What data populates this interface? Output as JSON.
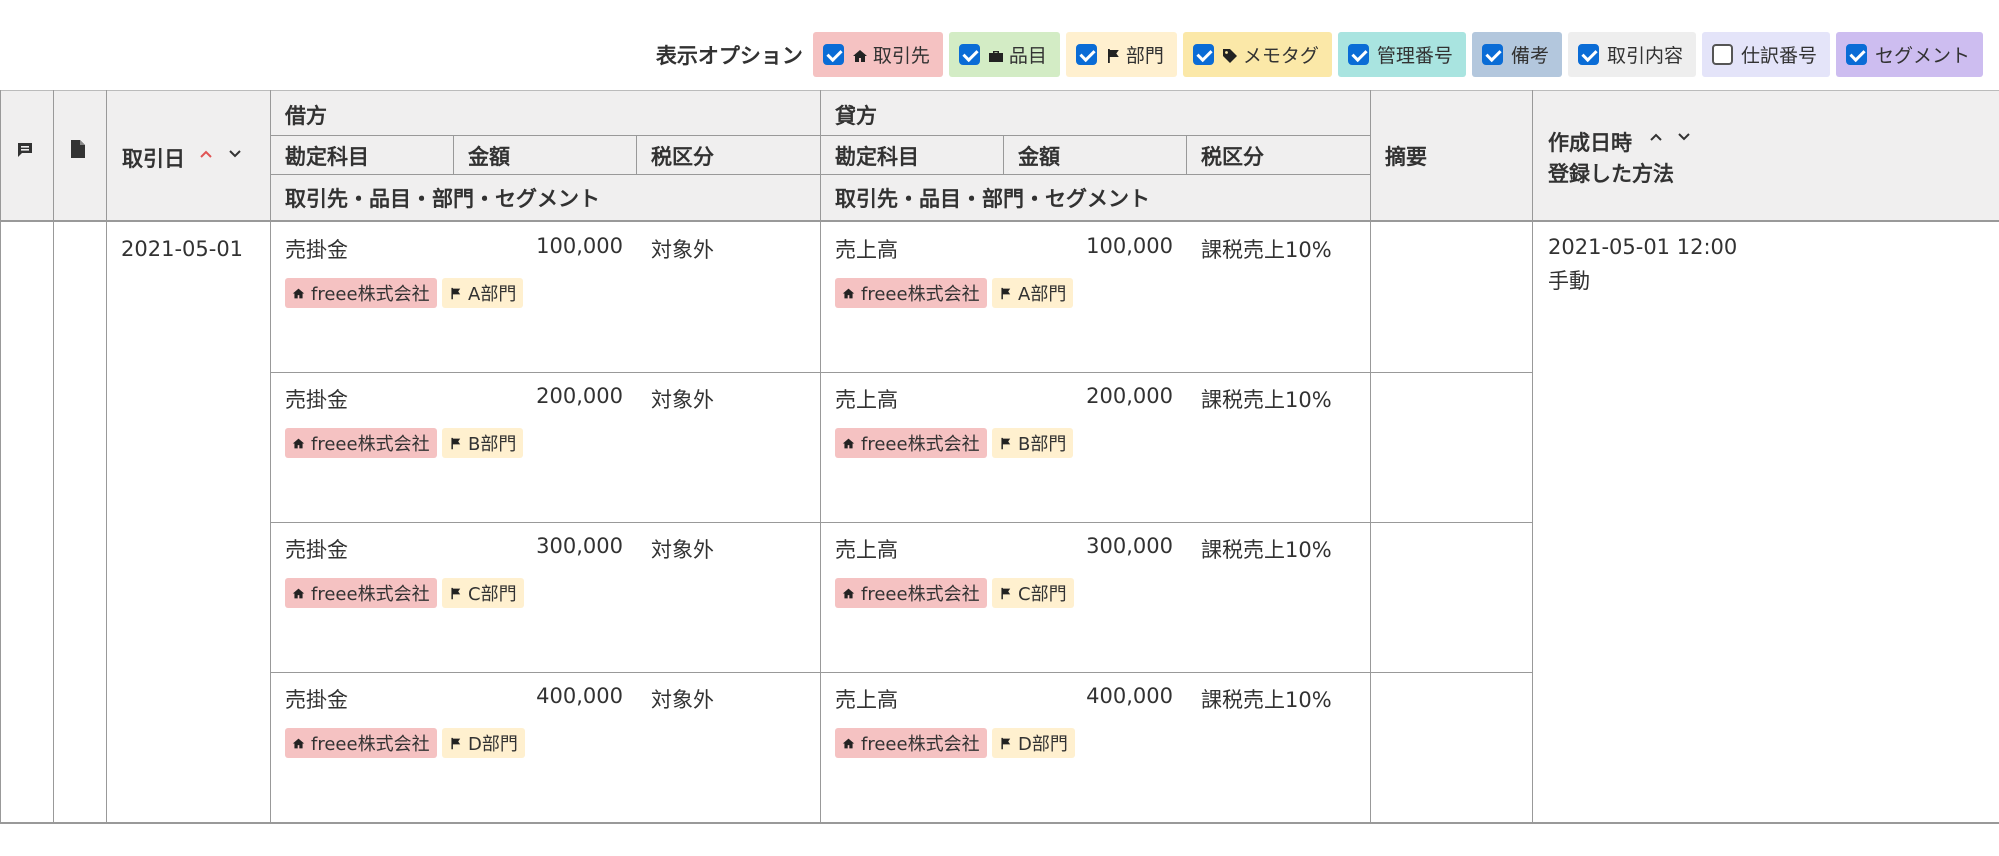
{
  "options": {
    "label": "表示オプション",
    "items": [
      {
        "label": "取引先",
        "checked": true,
        "bg": "#f5c2c2",
        "icon": "home-icon"
      },
      {
        "label": "品目",
        "checked": true,
        "bg": "#d3ecc5",
        "icon": "briefcase-icon"
      },
      {
        "label": "部門",
        "checked": true,
        "bg": "#fff0cf",
        "icon": "flag-icon"
      },
      {
        "label": "メモタグ",
        "checked": true,
        "bg": "#fbe8a8",
        "icon": "tag-icon"
      },
      {
        "label": "管理番号",
        "checked": true,
        "bg": "#a9e4e0",
        "icon": ""
      },
      {
        "label": "備考",
        "checked": true,
        "bg": "#b3c7dd",
        "icon": ""
      },
      {
        "label": "取引内容",
        "checked": true,
        "bg": "#eeeeee",
        "icon": ""
      },
      {
        "label": "仕訳番号",
        "checked": false,
        "bg": "#e4e4f9",
        "icon": ""
      },
      {
        "label": "セグメント",
        "checked": true,
        "bg": "#cdbdf0",
        "icon": ""
      }
    ]
  },
  "header": {
    "date": "取引日",
    "debit": "借方",
    "credit": "貸方",
    "account": "勘定科目",
    "amount": "金額",
    "tax": "税区分",
    "tags": "取引先・品目・部門・セグメント",
    "summary": "摘要",
    "created": "作成日時",
    "method": "登録した方法"
  },
  "entry": {
    "date": "2021-05-01",
    "created": "2021-05-01 12:00",
    "method": "手動"
  },
  "rows": [
    {
      "debit_account": "売掛金",
      "debit_amount": "100,000",
      "debit_tax": "対象外",
      "credit_account": "売上高",
      "credit_amount": "100,000",
      "credit_tax": "課税売上10%",
      "partner": "freee株式会社",
      "dept": "A部門"
    },
    {
      "debit_account": "売掛金",
      "debit_amount": "200,000",
      "debit_tax": "対象外",
      "credit_account": "売上高",
      "credit_amount": "200,000",
      "credit_tax": "課税売上10%",
      "partner": "freee株式会社",
      "dept": "B部門"
    },
    {
      "debit_account": "売掛金",
      "debit_amount": "300,000",
      "debit_tax": "対象外",
      "credit_account": "売上高",
      "credit_amount": "300,000",
      "credit_tax": "課税売上10%",
      "partner": "freee株式会社",
      "dept": "C部門"
    },
    {
      "debit_account": "売掛金",
      "debit_amount": "400,000",
      "debit_tax": "対象外",
      "credit_account": "売上高",
      "credit_amount": "400,000",
      "credit_tax": "課税売上10%",
      "partner": "freee株式会社",
      "dept": "D部門"
    }
  ],
  "colors": {
    "sort_active": "#e05454",
    "checkbox": "#0a6cd6",
    "header_bg": "#f0efef",
    "partner_tag": "#f5c2c2",
    "dept_tag": "#fff0cf"
  }
}
